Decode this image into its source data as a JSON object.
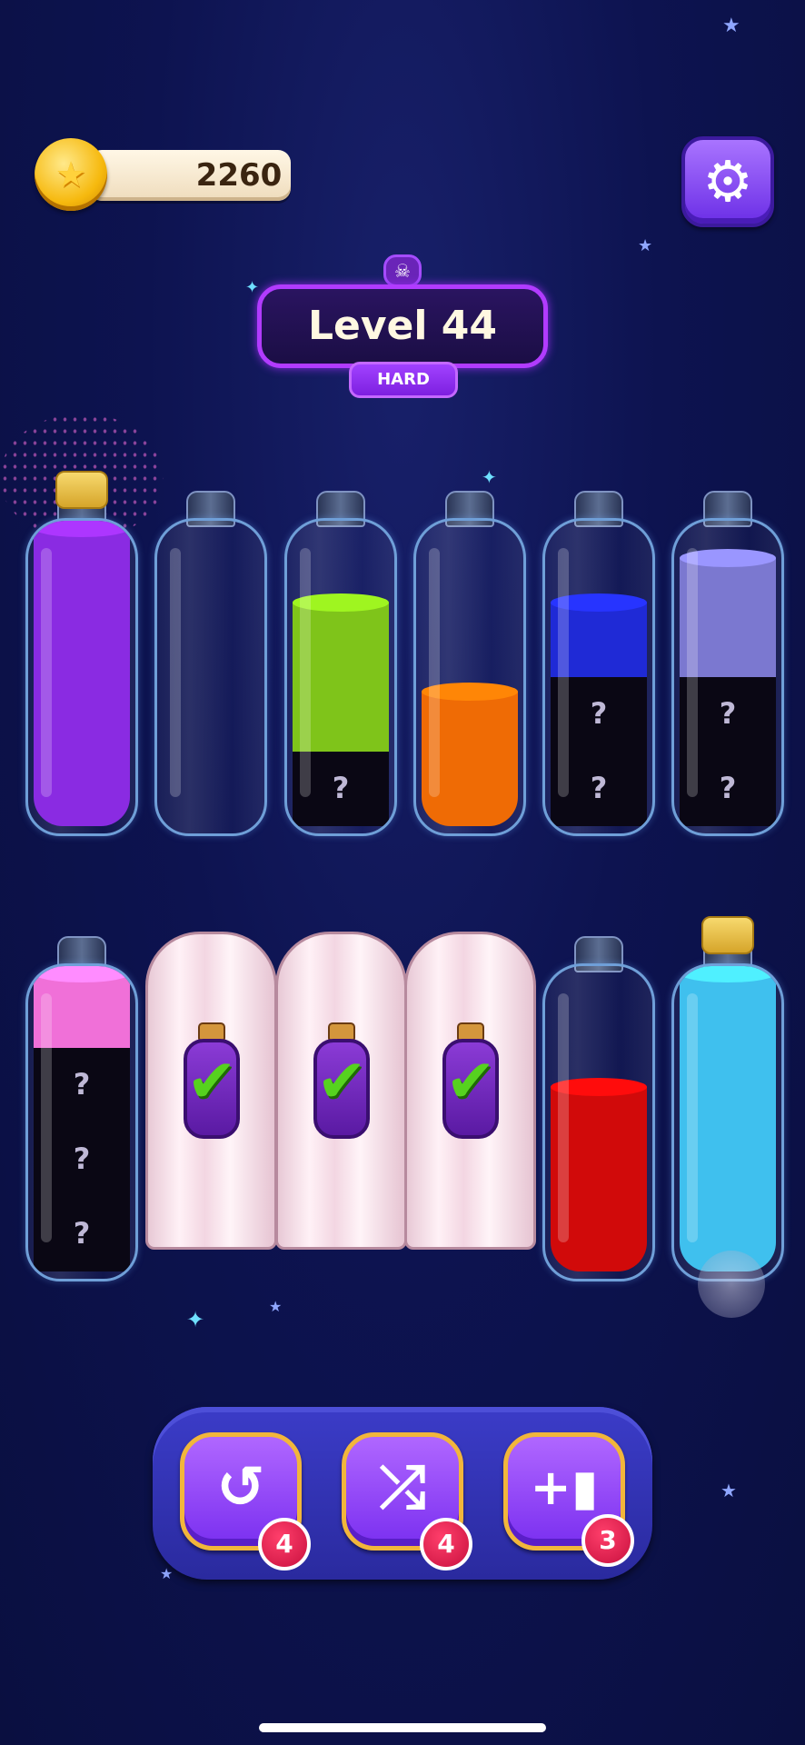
{
  "coins": {
    "value": "2260",
    "icon": "star-coin-icon"
  },
  "settings": {
    "icon": "gear-icon",
    "glyph": "⚙"
  },
  "level": {
    "skull_glyph": "☠",
    "title": "Level 44",
    "difficulty": "HARD"
  },
  "bottles_top": [
    {
      "name": "bottle-1",
      "corked": true,
      "layers": [
        {
          "color": "#8a2be2",
          "fill": 1.0
        }
      ],
      "hidden": 0
    },
    {
      "name": "bottle-2",
      "corked": false,
      "layers": [],
      "hidden": 0
    },
    {
      "name": "bottle-3",
      "corked": false,
      "layers": [
        {
          "color": "#7fc41a",
          "fill": 0.5
        }
      ],
      "hidden": 1
    },
    {
      "name": "bottle-4",
      "corked": false,
      "layers": [
        {
          "color": "#ef6b05",
          "fill": 0.45
        }
      ],
      "hidden": 0
    },
    {
      "name": "bottle-5",
      "corked": false,
      "layers": [
        {
          "color": "#1f2ad6",
          "fill": 0.25
        }
      ],
      "hidden": 2
    },
    {
      "name": "bottle-6",
      "corked": false,
      "layers": [
        {
          "color": "#7b78d0",
          "fill": 0.4
        }
      ],
      "hidden": 2
    }
  ],
  "bottles_bottom": [
    {
      "name": "bottle-7",
      "corked": false,
      "layers": [
        {
          "color": "#f070d8",
          "fill": 0.25
        }
      ],
      "hidden": 3
    },
    {
      "name": "bottle-8",
      "covered": true
    },
    {
      "name": "bottle-9",
      "covered": true
    },
    {
      "name": "bottle-10",
      "covered": true
    },
    {
      "name": "bottle-11",
      "corked": false,
      "layers": [
        {
          "color": "#d10a0a",
          "fill": 0.62
        }
      ],
      "hidden": 0
    },
    {
      "name": "bottle-12",
      "corked": true,
      "layers": [
        {
          "color": "#3fc0ee",
          "fill": 1.0
        }
      ],
      "hidden": 0
    }
  ],
  "hidden_mark": "?",
  "check_glyph": "✔",
  "tools": {
    "undo": {
      "glyph": "↺",
      "count": "4",
      "icon": "undo-icon"
    },
    "shuffle": {
      "glyph": "⤮",
      "count": "4",
      "icon": "shuffle-icon"
    },
    "add_bottle": {
      "glyph": "+▮",
      "count": "3",
      "icon": "add-bottle-icon"
    }
  }
}
